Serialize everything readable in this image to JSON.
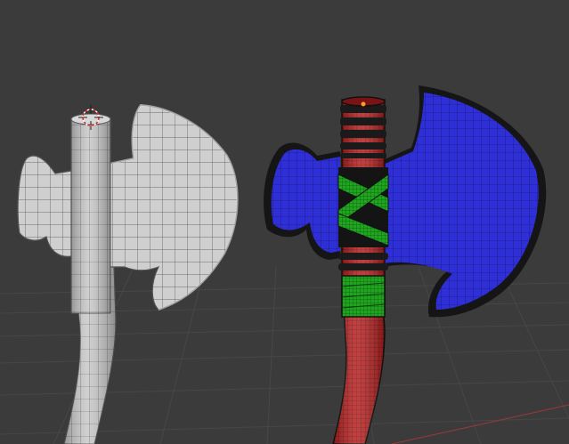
{
  "viewport": {
    "background": "#3b3b3b",
    "grid_color": "#464646",
    "axis_x_color": "#8a3a3a"
  },
  "left_model": {
    "shading": "solid-wireframe",
    "base_color": "#cfcfcf",
    "wire_color": "#3a3a3a"
  },
  "right_model": {
    "shading": "textured-wireframe",
    "blade_color": "#2f2fd8",
    "handle_color": "#b81f1f",
    "wrap_color": "#1fa51f",
    "band_color": "#1a1a1a"
  },
  "cursor": {
    "icon": "3d-cursor-icon"
  }
}
